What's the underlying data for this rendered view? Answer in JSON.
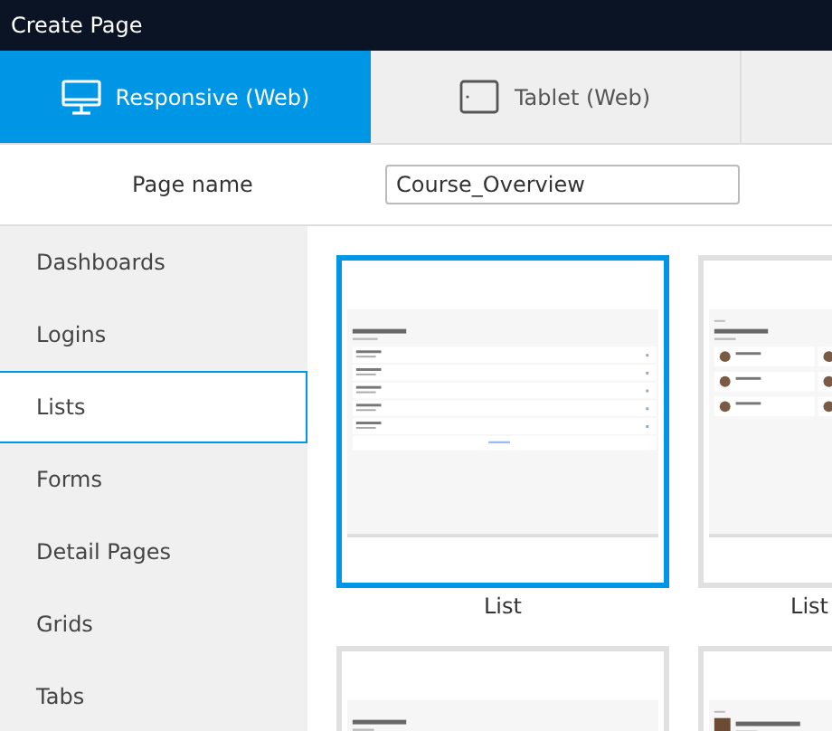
{
  "window": {
    "title": "Create Page"
  },
  "tabs": [
    {
      "kind": "monitor",
      "label": "Responsive (Web)",
      "selected": true
    },
    {
      "kind": "tablet",
      "label": "Tablet (Web)",
      "selected": false
    }
  ],
  "page_name": {
    "label": "Page name",
    "value": "Course_Overview"
  },
  "sidebar": {
    "items": [
      {
        "label": "Dashboards",
        "selected": false
      },
      {
        "label": "Logins",
        "selected": false
      },
      {
        "label": "Lists",
        "selected": true
      },
      {
        "label": "Forms",
        "selected": false
      },
      {
        "label": "Detail Pages",
        "selected": false
      },
      {
        "label": "Grids",
        "selected": false
      },
      {
        "label": "Tabs",
        "selected": false
      }
    ]
  },
  "templates": [
    {
      "kind": "list",
      "label": "List",
      "selected": true
    },
    {
      "kind": "avatar-list",
      "label": "List",
      "selected": false
    },
    {
      "kind": "split",
      "selected": false
    },
    {
      "kind": "header-avatar",
      "selected": false
    }
  ]
}
